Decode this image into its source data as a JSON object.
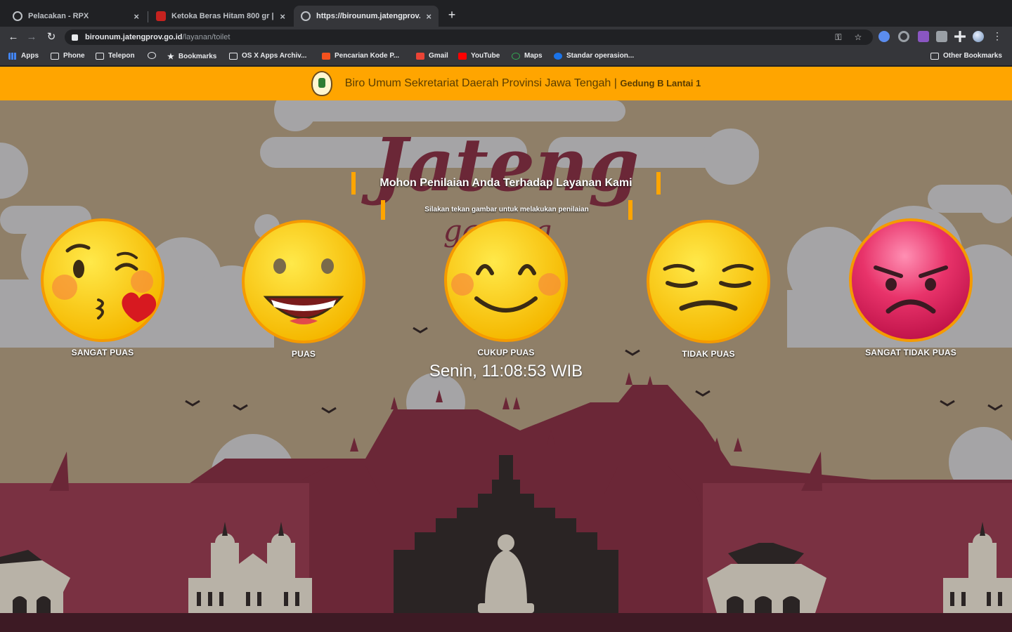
{
  "browser": {
    "tabs": [
      {
        "title": "Pelacakan - RPX",
        "active": false
      },
      {
        "title": "Ketoka Beras Hitam 800 gr | ...",
        "active": false
      },
      {
        "title": "https://birounum.jatengprov.go.id",
        "active": true
      }
    ],
    "url_host": "birounum.jatengprov.go.id",
    "url_path": "/layanan/toilet",
    "bookmarks": [
      {
        "label": "Apps",
        "icon": "apps-icon"
      },
      {
        "label": "Phone",
        "icon": "folder-icon"
      },
      {
        "label": "Telepon",
        "icon": "folder-icon"
      },
      {
        "label": "",
        "icon": "globe-icon"
      },
      {
        "label": "Bookmarks",
        "icon": "star-icon"
      },
      {
        "label": "OS X Apps Archiv...",
        "icon": "apps-icon"
      },
      {
        "label": "Pencarian Kode P...",
        "icon": "bookmark-icon"
      },
      {
        "label": "Gmail",
        "icon": "gmail-icon"
      },
      {
        "label": "YouTube",
        "icon": "youtube-icon"
      },
      {
        "label": "Maps",
        "icon": "maps-icon"
      },
      {
        "label": "Standar operasion...",
        "icon": "bookmark-icon"
      }
    ],
    "other_bookmarks": "Other Bookmarks"
  },
  "header": {
    "title": "Biro Umum Sekretariat Daerah Provinsi Jawa Tengah |",
    "location": "Gedung B Lantai 1"
  },
  "brand": {
    "wordmark": "Jateng",
    "sub": "gayeng"
  },
  "prompt": {
    "main": "Mohon Penilaian Anda Terhadap Layanan Kami",
    "sub": "Silakan tekan gambar untuk melakukan penilaian"
  },
  "ratings": [
    {
      "label": "SANGAT PUAS",
      "icon": "kissing-face-icon"
    },
    {
      "label": "PUAS",
      "icon": "grinning-face-icon"
    },
    {
      "label": "CUKUP PUAS",
      "icon": "smiling-face-icon"
    },
    {
      "label": "TIDAK PUAS",
      "icon": "pensive-face-icon"
    },
    {
      "label": "SANGAT TIDAK PUAS",
      "icon": "angry-face-icon"
    }
  ],
  "clock": "Senin, 11:08:53 WIB",
  "colors": {
    "header": "#ffa500",
    "sky": "#8f7f68",
    "hills": "#6b2737",
    "cloud": "#a5a4a6"
  }
}
